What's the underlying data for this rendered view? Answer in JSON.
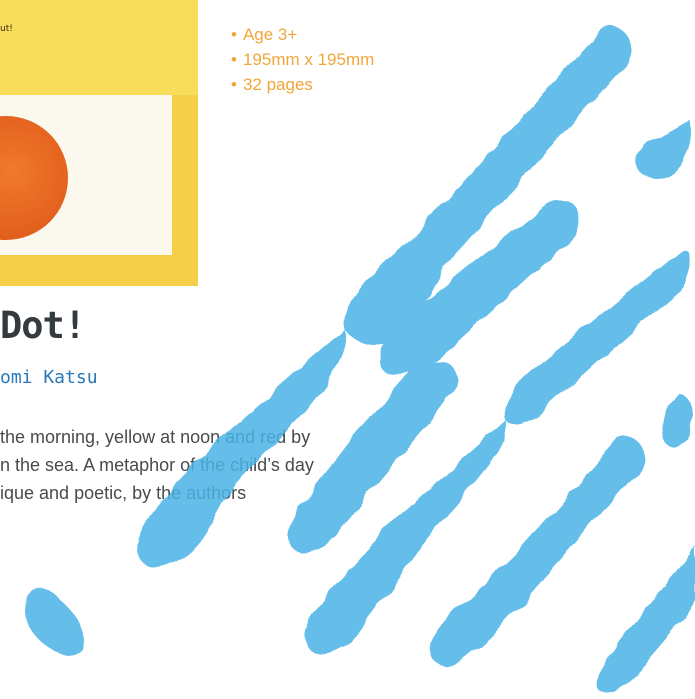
{
  "cover": {
    "text": "ut!",
    "colors": {
      "background": "#f5cf47",
      "panel": "#fbf8ee",
      "dot": "#e4621e"
    }
  },
  "specs": [
    "Age 3+",
    "195mm x 195mm",
    "32 pages"
  ],
  "book": {
    "title": "Dot!",
    "authors": "omi Katsu",
    "description_lines": [
      "the morning, yellow at noon and red by",
      "n the sea. A metaphor of the child’s day",
      "ique and poetic, by the authors"
    ]
  },
  "colors": {
    "accent": "#f1a63a",
    "link": "#2a78b8",
    "watercolor": "#48b3e6"
  }
}
